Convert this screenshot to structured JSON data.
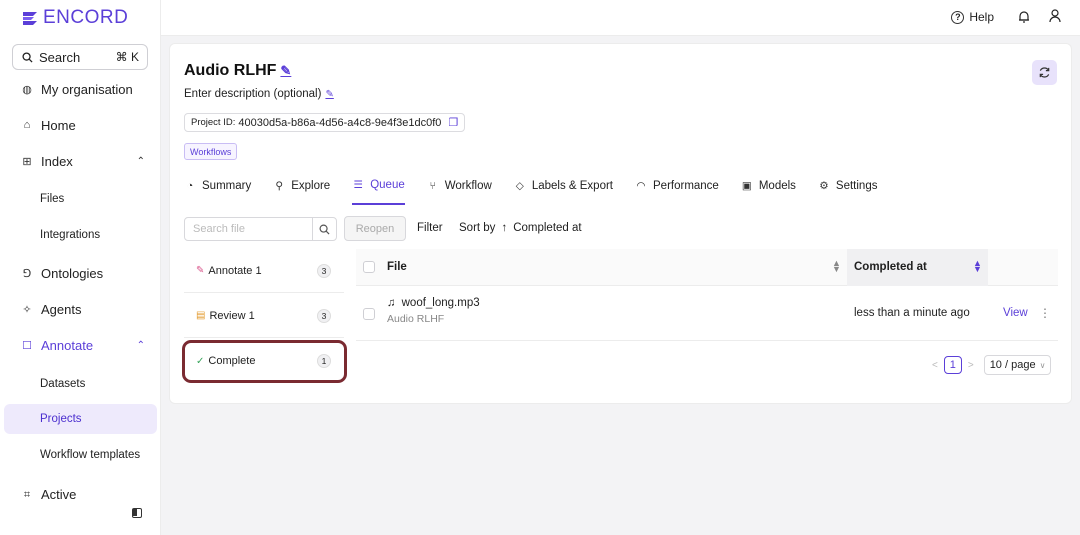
{
  "app": {
    "logo_text": "ENCORD"
  },
  "sidebar": {
    "search_label": "Search",
    "search_shortcut": "⌘ K",
    "items": [
      {
        "label": "My organisation",
        "icon": "globe-icon"
      },
      {
        "label": "Home",
        "icon": "home-icon"
      },
      {
        "label": "Index",
        "icon": "index-icon"
      },
      {
        "label": "Files"
      },
      {
        "label": "Integrations"
      },
      {
        "label": "Ontologies",
        "icon": "ontology-icon"
      },
      {
        "label": "Agents",
        "icon": "agents-icon"
      },
      {
        "label": "Annotate",
        "icon": "annotate-icon"
      },
      {
        "label": "Datasets"
      },
      {
        "label": "Projects"
      },
      {
        "label": "Workflow templates"
      },
      {
        "label": "Active",
        "icon": "active-icon"
      }
    ]
  },
  "topbar": {
    "help_label": "Help"
  },
  "project": {
    "title": "Audio RLHF",
    "description_placeholder": "Enter description (optional)",
    "id_label": "Project ID:",
    "id_value": "40030d5a-b86a-4d56-a4c8-9e4f3e1dc0f0",
    "tag": "Workflows"
  },
  "tabs": [
    {
      "label": "Summary",
      "icon": "summary-icon"
    },
    {
      "label": "Explore",
      "icon": "explore-icon"
    },
    {
      "label": "Queue",
      "icon": "queue-icon",
      "active": true
    },
    {
      "label": "Workflow",
      "icon": "workflow-icon"
    },
    {
      "label": "Labels & Export",
      "icon": "labels-icon"
    },
    {
      "label": "Performance",
      "icon": "performance-icon"
    },
    {
      "label": "Models",
      "icon": "models-icon"
    },
    {
      "label": "Settings",
      "icon": "settings-icon"
    }
  ],
  "toolbar": {
    "search_placeholder": "Search file",
    "reopen_label": "Reopen",
    "filter_label": "Filter",
    "sort_label": "Sort by",
    "sort_value": "Completed at"
  },
  "stages": [
    {
      "label": "Annotate 1",
      "count": "3",
      "icon": "annotate-stage-icon"
    },
    {
      "label": "Review 1",
      "count": "3",
      "icon": "review-stage-icon"
    },
    {
      "label": "Complete",
      "count": "1",
      "icon": "complete-check-icon"
    }
  ],
  "table": {
    "columns": [
      "File",
      "Completed at"
    ],
    "rows": [
      {
        "file": "woof_long.mp3",
        "project": "Audio RLHF",
        "completed_at": "less than a minute ago",
        "action": "View"
      }
    ]
  },
  "pagination": {
    "page": "1",
    "page_size": "10 / page"
  },
  "colors": {
    "accent": "#5b3fd8",
    "highlight_border": "#7a2a31"
  }
}
